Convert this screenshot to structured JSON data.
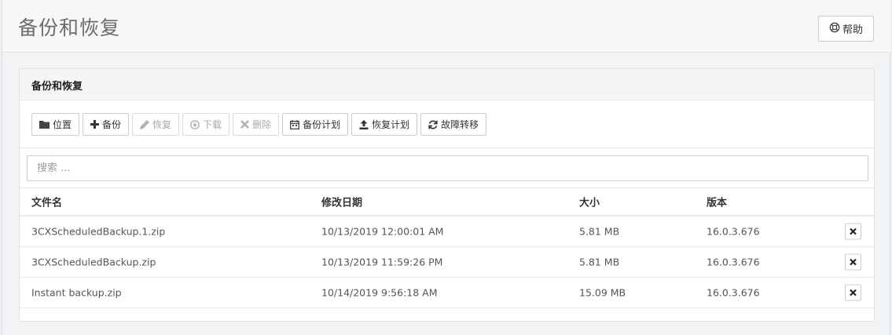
{
  "page": {
    "title": "备份和恢复"
  },
  "help": {
    "label": "帮助"
  },
  "panel": {
    "title": "备份和恢复"
  },
  "toolbar": {
    "location": "位置",
    "backup": "备份",
    "restore": "恢复",
    "download": "下载",
    "delete": "删除",
    "backup_schedule": "备份计划",
    "restore_schedule": "恢复计划",
    "failover": "故障转移"
  },
  "search": {
    "placeholder": "搜索 ..."
  },
  "table": {
    "headers": {
      "name": "文件名",
      "modified": "修改日期",
      "size": "大小",
      "version": "版本"
    },
    "rows": [
      {
        "name": "3CXScheduledBackup.1.zip",
        "modified": "10/13/2019 12:00:01 AM",
        "size": "5.81 MB",
        "version": "16.0.3.676"
      },
      {
        "name": "3CXScheduledBackup.zip",
        "modified": "10/13/2019 11:59:26 PM",
        "size": "5.81 MB",
        "version": "16.0.3.676"
      },
      {
        "name": "Instant backup.zip",
        "modified": "10/14/2019 9:56:18 AM",
        "size": "15.09 MB",
        "version": "16.0.3.676"
      }
    ]
  },
  "colors": {
    "disabled_text": "#a5a8ab",
    "heading_bg": "#f5f5f5"
  }
}
